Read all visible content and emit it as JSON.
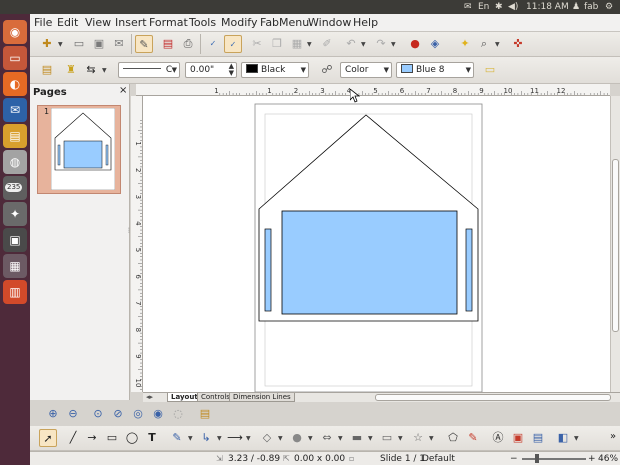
{
  "top_panel": {
    "keyboard": "En",
    "time": "11:18 AM",
    "user": "fab"
  },
  "launcher": {
    "items": [
      {
        "name": "dash-home",
        "glyph": "◉",
        "color": "#d96c3b"
      },
      {
        "name": "files-folder",
        "glyph": "▭",
        "color": "#c4573a"
      },
      {
        "name": "firefox",
        "glyph": "◐",
        "color": "#e66a24"
      },
      {
        "name": "thunderbird",
        "glyph": "✉",
        "color": "#2d62a8"
      },
      {
        "name": "libreoffice-impress",
        "glyph": "▤",
        "color": "#d89f2d"
      },
      {
        "name": "software-center",
        "glyph": "◍",
        "color": "#a3a3a3"
      },
      {
        "name": "update-manager",
        "glyph": "↻",
        "color": "#5f5f5f",
        "badge": "235"
      },
      {
        "name": "system-settings",
        "glyph": "✦",
        "color": "#6a6a6a"
      },
      {
        "name": "terminal",
        "glyph": "▣",
        "color": "#4a4a4a"
      },
      {
        "name": "workspace-switcher",
        "glyph": "▦",
        "color": "#6c5a64"
      },
      {
        "name": "trash",
        "glyph": "▥",
        "color": "#d24a2a"
      }
    ]
  },
  "menubar": {
    "items": [
      "File",
      "Edit",
      "View",
      "Insert",
      "Format",
      "Tools",
      "Modify",
      "FabMenu",
      "Window",
      "Help"
    ]
  },
  "line_toolbar": {
    "line_style_value": "C",
    "line_width_value": "0.00\"",
    "line_color_value": "Black",
    "line_color_hex": "#000000",
    "area_style_value": "Color",
    "fill_color_value": "Blue 8",
    "fill_color_hex": "#99ccff"
  },
  "pages_pane": {
    "title": "Pages",
    "close_glyph": "×",
    "pages": [
      {
        "number": "1"
      }
    ]
  },
  "ruler_top": {
    "labels": [
      "1",
      "1",
      "2",
      "3",
      "4",
      "5",
      "6",
      "7",
      "8",
      "9",
      "10",
      "11",
      "12"
    ]
  },
  "ruler_left": {
    "labels": [
      "1",
      "2",
      "3",
      "4",
      "5",
      "6",
      "7",
      "8",
      "9",
      "10"
    ]
  },
  "drawing": {
    "page_fill": "#ffffff",
    "house_fill": "#ffffff",
    "window_fill": "#99ccff",
    "side_bar_fill": "#99ccff",
    "outline_color": "#000000"
  },
  "layer_tabs": {
    "tabs": [
      "Layout",
      "Controls",
      "Dimension Lines"
    ],
    "active": 0
  },
  "statusbar": {
    "position": "3.23 / -0.89",
    "size": "0.00 x 0.00",
    "slide": "Slide 1 / 1",
    "layout": "Default",
    "zoom": "46%"
  },
  "colors": {
    "launcher_bg": "#4e2a3a",
    "panel_bg": "#3c3b37",
    "selection_thumb": "#e7b39c"
  }
}
